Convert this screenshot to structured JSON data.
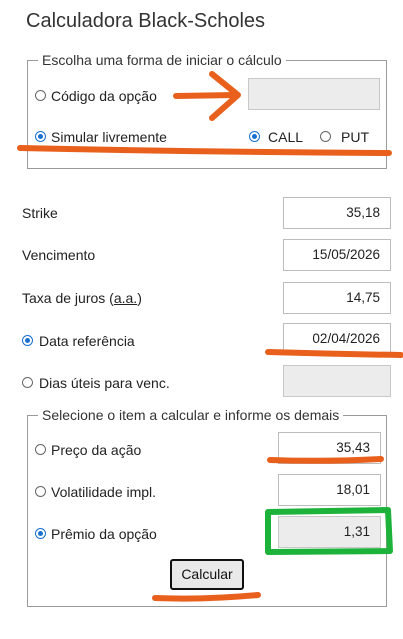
{
  "title": "Calculadora Black-Scholes",
  "start_group": {
    "legend": "Escolha uma forma de iniciar o cálculo",
    "option_code": {
      "label": "Código da opção",
      "selected": false,
      "value": ""
    },
    "simulate": {
      "label": "Simular livremente",
      "selected": true
    },
    "call": {
      "label": "CALL",
      "selected": true
    },
    "put": {
      "label": "PUT",
      "selected": false
    }
  },
  "params": {
    "strike": {
      "label": "Strike",
      "value": "35,18"
    },
    "expiry": {
      "label": "Vencimento",
      "value": "15/05/2026"
    },
    "rate": {
      "label_prefix": "Taxa de juros (",
      "label_abbr": "a.a.",
      "label_suffix": ")",
      "value": "14,75"
    },
    "ref_date": {
      "label": "Data referência",
      "value": "02/04/2026",
      "selected": true
    },
    "bus_days": {
      "label": "Dias úteis para venc.",
      "value": "",
      "selected": false
    }
  },
  "calc_group": {
    "legend": "Selecione o item a calcular e informe os demais",
    "stock_price": {
      "label": "Preço da ação",
      "value": "35,43",
      "selected": false
    },
    "volatility": {
      "label": "Volatilidade impl.",
      "value": "18,01",
      "selected": false
    },
    "premium": {
      "label": "Prêmio da opção",
      "value": "1,31",
      "selected": true
    }
  },
  "calculate_button": {
    "label": "Calcular"
  },
  "annotation_colors": {
    "orange": "#e8601c",
    "green": "#1db33a"
  }
}
